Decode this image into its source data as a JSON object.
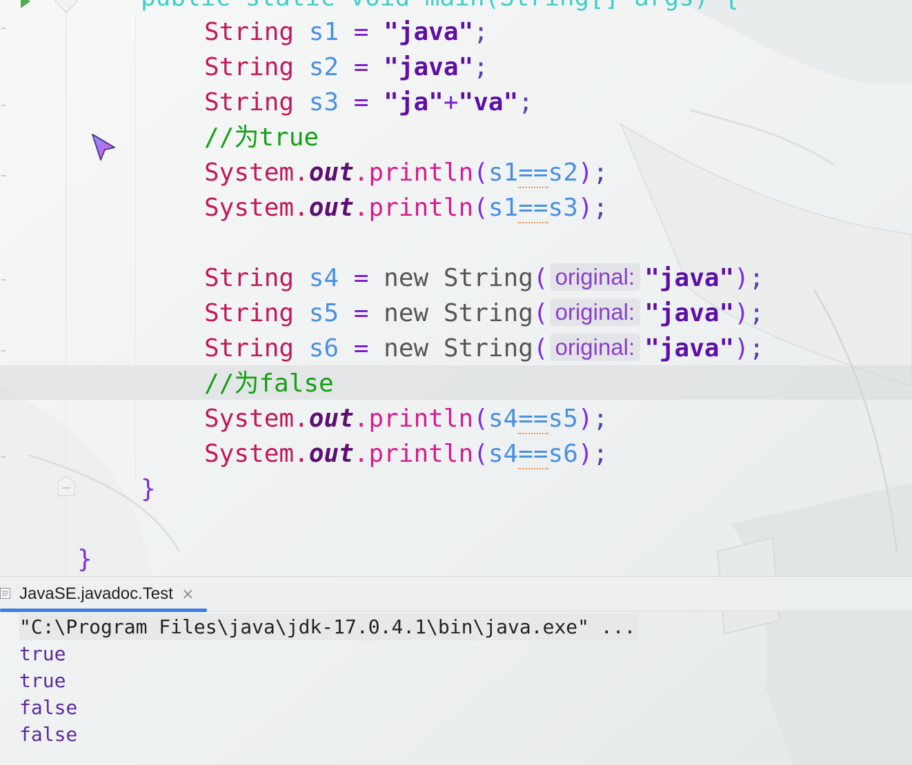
{
  "editor": {
    "header_partial": "public static void main(String[] args) {",
    "lines": {
      "l1": {
        "type": "String",
        "var": "s1",
        "eq": "=",
        "str": "\"java\"",
        "semi": ";"
      },
      "l2": {
        "type": "String",
        "var": "s2",
        "eq": "=",
        "str": "\"java\"",
        "semi": ";"
      },
      "l3": {
        "type": "String",
        "var": "s3",
        "eq": "=",
        "str_a": "\"ja\"",
        "plus": "+",
        "str_b": "\"va\"",
        "semi": ";"
      },
      "c1": "//为true",
      "p1": {
        "sys": "System.",
        "out": "out",
        "method": ".println",
        "open": "(",
        "a": "s1",
        "op": "==",
        "b": "s2",
        "close": ")",
        "semi": ";"
      },
      "p2": {
        "sys": "System.",
        "out": "out",
        "method": ".println",
        "open": "(",
        "a": "s1",
        "op": "==",
        "b": "s3",
        "close": ")",
        "semi": ";"
      },
      "l4": {
        "type": "String",
        "var": "s4",
        "eq": "=",
        "new": "new",
        "ctor": "String",
        "open": "(",
        "hint": "original:",
        "str": "\"java\"",
        "close": ")",
        "semi": ";"
      },
      "l5": {
        "type": "String",
        "var": "s5",
        "eq": "=",
        "new": "new",
        "ctor": "String",
        "open": "(",
        "hint": "original:",
        "str": "\"java\"",
        "close": ")",
        "semi": ";"
      },
      "l6": {
        "type": "String",
        "var": "s6",
        "eq": "=",
        "new": "new",
        "ctor": "String",
        "open": "(",
        "hint": "original:",
        "str": "\"java\"",
        "close": ")",
        "semi": ";"
      },
      "c2": "//为false",
      "p3": {
        "sys": "System.",
        "out": "out",
        "method": ".println",
        "open": "(",
        "a": "s4",
        "op": "==",
        "b": "s5",
        "close": ")",
        "semi": ";"
      },
      "p4": {
        "sys": "System.",
        "out": "out",
        "method": ".println",
        "open": "(",
        "a": "s4",
        "op": "==",
        "b": "s6",
        "close": ")",
        "semi": ";"
      },
      "close_method": "}",
      "close_class": "}"
    }
  },
  "run_panel": {
    "tab_title": "JavaSE.javadoc.Test",
    "tab_close": "×",
    "console": {
      "command": "\"C:\\Program Files\\java\\jdk-17.0.4.1\\bin\\java.exe\" ...",
      "output": [
        "true",
        "true",
        "false",
        "false"
      ]
    }
  },
  "colors": {
    "keyword": "#c2185b",
    "variable": "#4a90e2",
    "string": "#5d0fa6",
    "comment": "#14a114",
    "tab_underline": "#3d7ee0",
    "console_output": "#5d2a9e"
  }
}
